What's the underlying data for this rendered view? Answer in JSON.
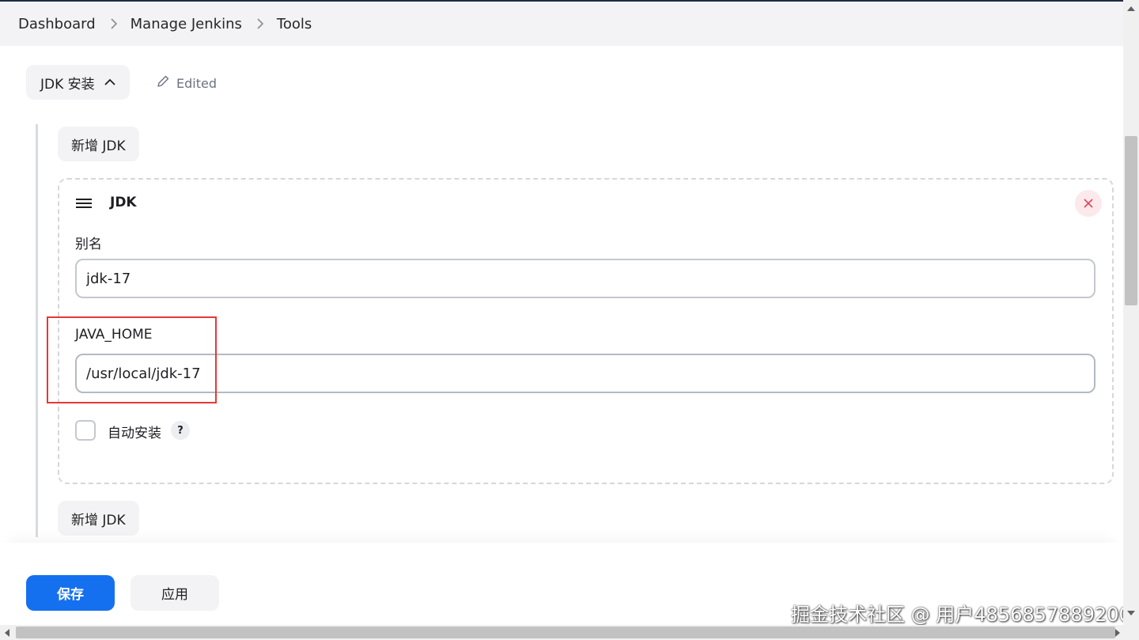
{
  "breadcrumb": {
    "items": [
      "Dashboard",
      "Manage Jenkins",
      "Tools"
    ]
  },
  "section": {
    "title": "JDK 安装",
    "edited_label": "Edited"
  },
  "add_jdk_label": "新增 JDK",
  "jdk_card": {
    "title": "JDK",
    "alias_label": "别名",
    "alias_value": "jdk-17",
    "java_home_label": "JAVA_HOME",
    "java_home_value": "/usr/local/jdk-17",
    "auto_install_label": "自动安装",
    "auto_install_checked": false,
    "help_label": "?"
  },
  "footer": {
    "save_label": "保存",
    "apply_label": "应用"
  },
  "watermark": "掘金技术社区 @ 用户4856857889200",
  "colors": {
    "primary": "#1570ef",
    "highlight": "#e53935",
    "panel": "#f3f3f5"
  },
  "icons": [
    "chevron-right-icon",
    "chevron-up-icon",
    "pencil-icon",
    "drag-handle-icon",
    "close-icon",
    "help-icon"
  ]
}
